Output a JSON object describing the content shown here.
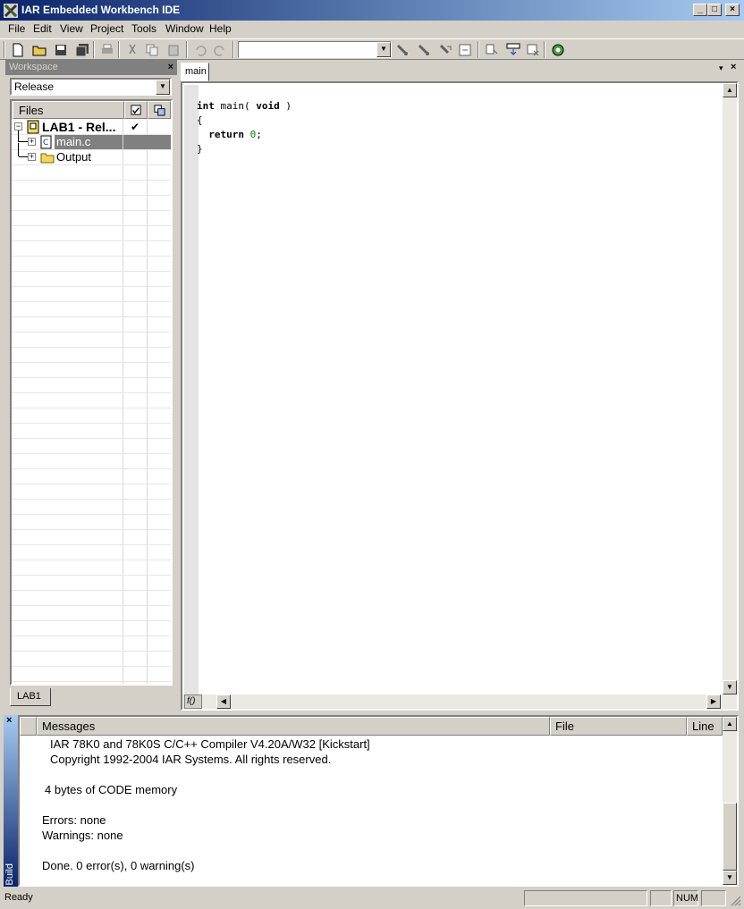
{
  "window": {
    "title": "IAR Embedded Workbench IDE"
  },
  "menu": [
    "File",
    "Edit",
    "View",
    "Project",
    "Tools",
    "Window",
    "Help"
  ],
  "toolbar": {
    "combo_value": ""
  },
  "workspace": {
    "title": "Workspace",
    "close_glyph": "×",
    "configuration": "Release",
    "column_files": "Files",
    "tree": [
      {
        "label": "LAB1 - Rel...",
        "checked": "✔"
      },
      {
        "label": "main.c"
      },
      {
        "label": "Output"
      }
    ],
    "tab": "LAB1"
  },
  "editor": {
    "tab": "main",
    "code_lines": [
      {
        "kw1": "int",
        "rest1": " main( ",
        "kw2": "void",
        "rest2": " )"
      },
      {
        "text": "{"
      },
      {
        "indent": "  ",
        "kw": "return",
        "num": "0",
        "tail": ";"
      },
      {
        "text": "}"
      }
    ],
    "func_box": "f()"
  },
  "build": {
    "side_label": "Build",
    "close_glyph": "×",
    "columns": {
      "messages": "Messages",
      "file": "File",
      "line": "Line"
    },
    "messages": [
      "IAR 78K0 and 78K0S C/C++ Compiler V4.20A/W32 [Kickstart]",
      "Copyright 1992-2004 IAR Systems. All rights reserved.",
      "4 bytes of CODE memory",
      "Errors: none",
      "Warnings: none",
      "Done. 0 error(s), 0 warning(s)"
    ]
  },
  "status": {
    "text": "Ready",
    "num": "NUM"
  }
}
